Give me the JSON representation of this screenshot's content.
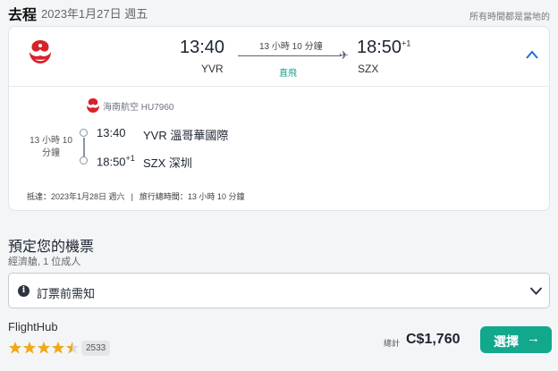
{
  "header": {
    "title": "去程",
    "date": "2023年1月27日 週五",
    "timezone_note": "所有時間都是當地的"
  },
  "flight": {
    "departure_time": "13:40",
    "departure_code": "YVR",
    "duration": "13 小時 10 分鐘",
    "stops": "直飛",
    "arrival_time": "18:50",
    "arrival_day_offset": "+1",
    "arrival_code": "SZX",
    "airline": "海南航空 HU7960",
    "segment_duration_line1": "13 小時 10",
    "segment_duration_line2": "分鐘",
    "segment_from_time": "13:40",
    "segment_from_place": "YVR 溫哥華國際",
    "segment_to_time": "18:50",
    "segment_to_offset": "+1",
    "segment_to_place": "SZX 深圳",
    "arrives_label": "抵達：",
    "arrives_value": "2023年1月28日 週六",
    "total_travel_label": "旅行總時間：",
    "total_travel_value": "13 小時 10 分鐘",
    "separator": "|",
    "icons": {
      "expand": "chevron-up-icon",
      "plane": "airplane-icon"
    }
  },
  "booking": {
    "title": "預定您的機票",
    "subtitle": "經濟艙, 1 位成人",
    "notice_label": "訂票前需知",
    "notice_icon": "info-icon",
    "info_glyph": "i"
  },
  "offer": {
    "provider": "FlightHub",
    "rating": 4.5,
    "review_count": "2533",
    "total_label": "總計",
    "price": "C$1,760",
    "select_label": "選擇",
    "select_arrow": "→",
    "accent_color": "#11a88e",
    "star_color": "#f0a91b"
  },
  "airline_brand_color": "#d6232a"
}
